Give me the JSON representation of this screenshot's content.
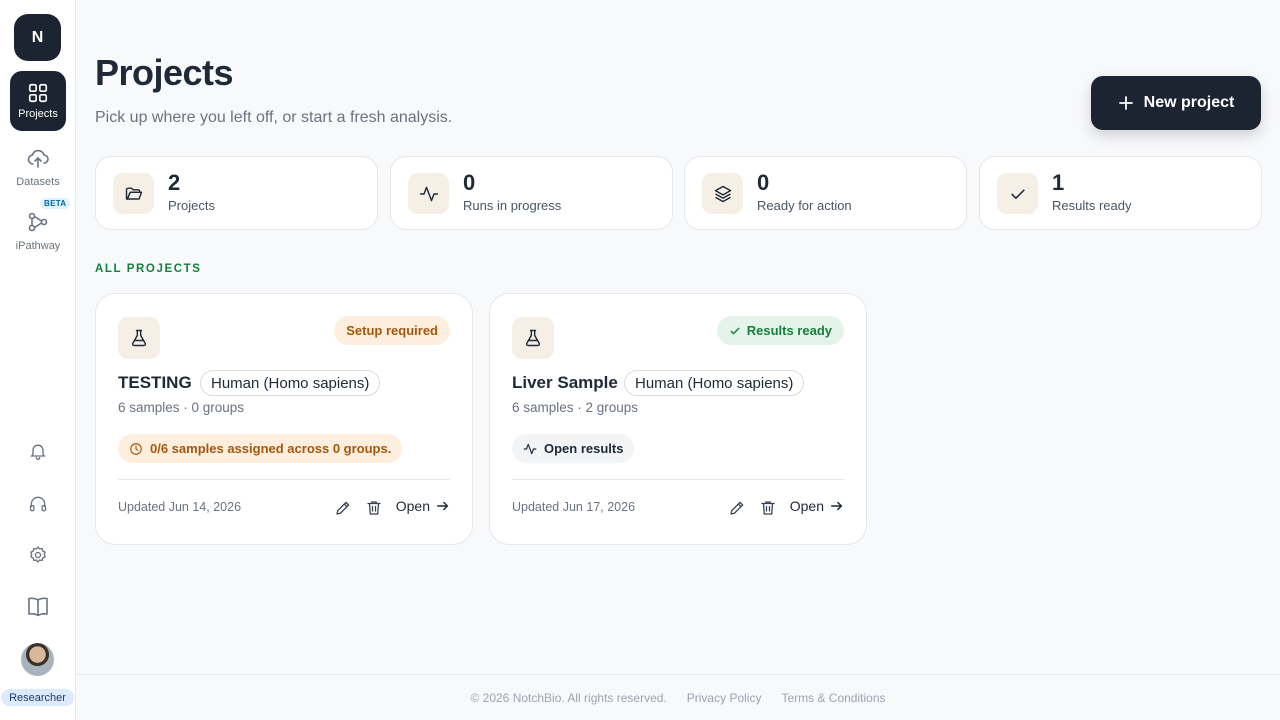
{
  "sidebar": {
    "logo": "N",
    "items": [
      {
        "label": "Projects",
        "icon": "grid-icon"
      },
      {
        "label": "Datasets",
        "icon": "cloud-upload-icon"
      },
      {
        "label": "iPathway",
        "icon": "pathway-icon",
        "badge": "BETA"
      }
    ],
    "bottom_icons": [
      "bell-icon",
      "headset-icon",
      "gear-icon",
      "book-icon"
    ],
    "role": "Researcher"
  },
  "header": {
    "title": "Projects",
    "subtitle": "Pick up where you left off, or start a fresh analysis.",
    "new_project_label": "New project"
  },
  "stats": [
    {
      "value": "2",
      "label": "Projects",
      "icon": "folder-icon"
    },
    {
      "value": "0",
      "label": "Runs in progress",
      "icon": "activity-icon"
    },
    {
      "value": "0",
      "label": "Ready for action",
      "icon": "layers-icon"
    },
    {
      "value": "1",
      "label": "Results ready",
      "icon": "check-icon"
    }
  ],
  "section_label": "ALL PROJECTS",
  "projects": [
    {
      "name": "TESTING",
      "species": "Human (Homo sapiens)",
      "meta": "6 samples · 0 groups",
      "status": "Setup required",
      "note": "0/6 samples assigned across 0 groups.",
      "updated": "Updated Jun 14, 2026",
      "open_label": "Open"
    },
    {
      "name": "Liver Sample",
      "species": "Human (Homo sapiens)",
      "meta": "6 samples · 2 groups",
      "status": "Results ready",
      "note": "Open results",
      "updated": "Updated Jun 17, 2026",
      "open_label": "Open"
    }
  ],
  "footer": {
    "copyright": "© 2026 NotchBio. All rights reserved.",
    "privacy": "Privacy Policy",
    "terms": "Terms & Conditions"
  },
  "colors": {
    "accent_dark": "#1b2430",
    "section_green": "#15803d",
    "warn_bg": "#fdeedd",
    "ready_bg": "#e4f4ea"
  }
}
